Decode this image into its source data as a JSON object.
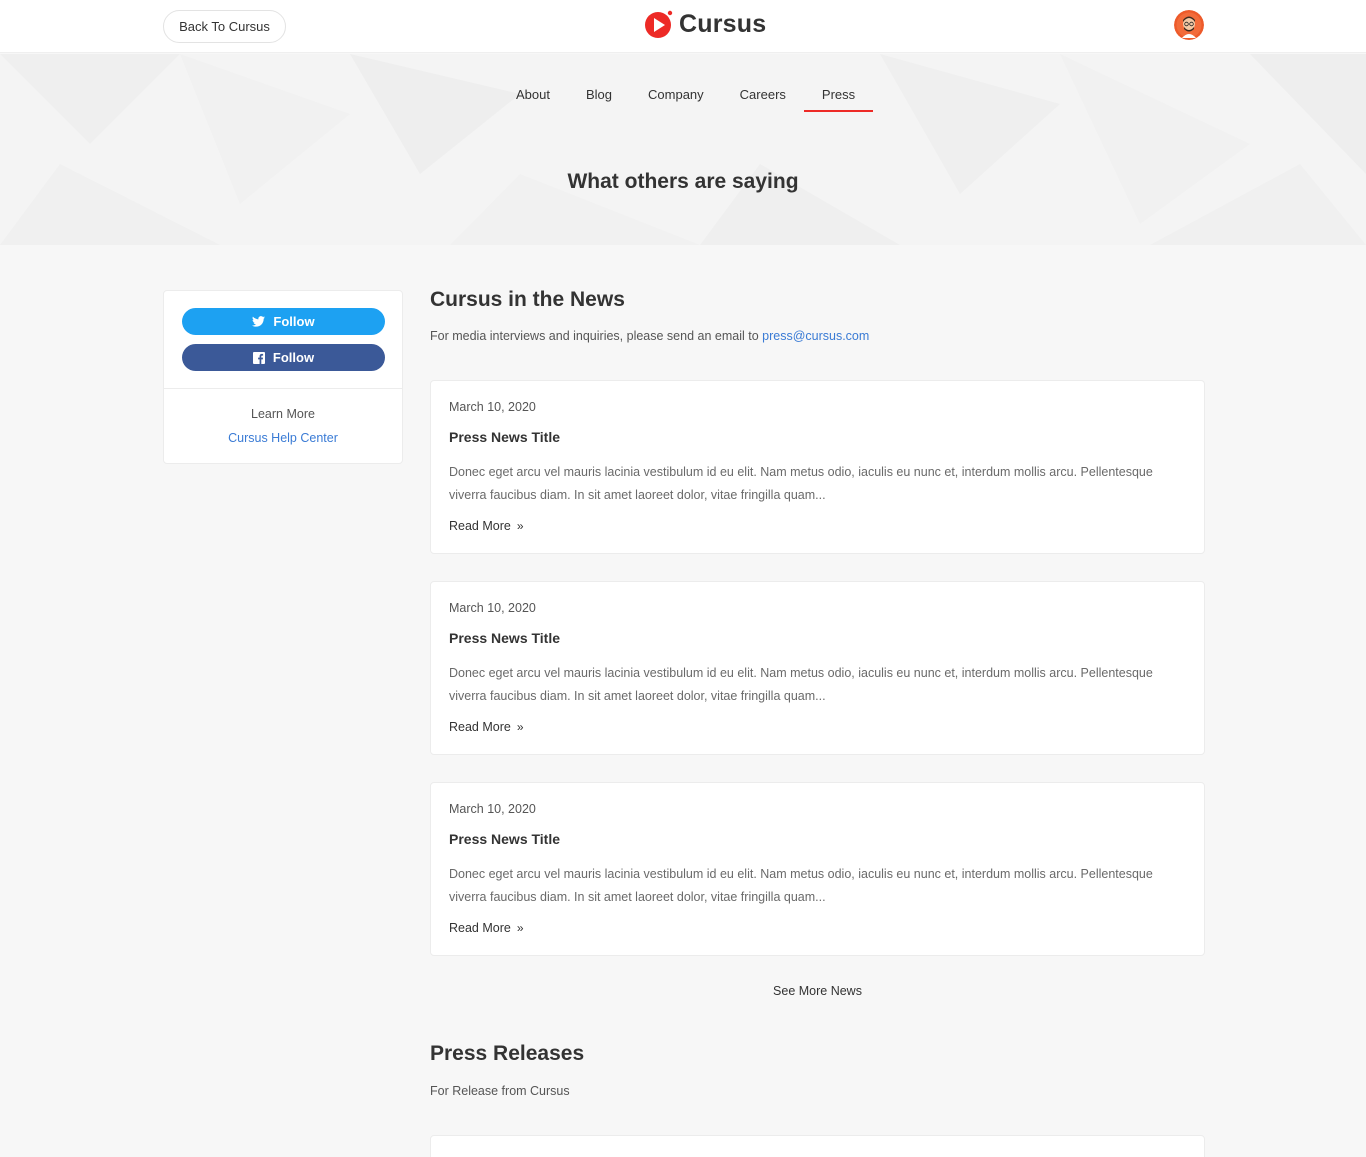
{
  "header": {
    "back_label": "Back To Cursus",
    "logo_text": "Cursus",
    "logo_color": "#ed2a26"
  },
  "nav": {
    "tabs": [
      {
        "label": "About",
        "active": false
      },
      {
        "label": "Blog",
        "active": false
      },
      {
        "label": "Company",
        "active": false
      },
      {
        "label": "Careers",
        "active": false
      },
      {
        "label": "Press",
        "active": true
      }
    ]
  },
  "hero": {
    "title": "What others are saying"
  },
  "sidebar": {
    "twitter_label": "Follow",
    "twitter_color": "#1da1f2",
    "facebook_label": "Follow",
    "facebook_color": "#3b5998",
    "learn_more": "Learn More",
    "help_link": "Cursus Help Center"
  },
  "news": {
    "title": "Cursus in the News",
    "subtitle": "For media interviews and inquiries, please send an email to",
    "email": "press@cursus.com",
    "items": [
      {
        "date": "March 10, 2020",
        "title": "Press News Title",
        "excerpt": "Donec eget arcu vel mauris lacinia vestibulum id eu elit. Nam metus odio, iaculis eu nunc et, interdum mollis arcu. Pellentesque viverra faucibus diam. In sit amet laoreet dolor, vitae fringilla quam...",
        "read_more": "Read More"
      },
      {
        "date": "March 10, 2020",
        "title": "Press News Title",
        "excerpt": "Donec eget arcu vel mauris lacinia vestibulum id eu elit. Nam metus odio, iaculis eu nunc et, interdum mollis arcu. Pellentesque viverra faucibus diam. In sit amet laoreet dolor, vitae fringilla quam...",
        "read_more": "Read More"
      },
      {
        "date": "March 10, 2020",
        "title": "Press News Title",
        "excerpt": "Donec eget arcu vel mauris lacinia vestibulum id eu elit. Nam metus odio, iaculis eu nunc et, interdum mollis arcu. Pellentesque viverra faucibus diam. In sit amet laoreet dolor, vitae fringilla quam...",
        "read_more": "Read More"
      }
    ],
    "see_more": "See More News"
  },
  "releases": {
    "title": "Press Releases",
    "subtitle": "For Release from Cursus"
  }
}
